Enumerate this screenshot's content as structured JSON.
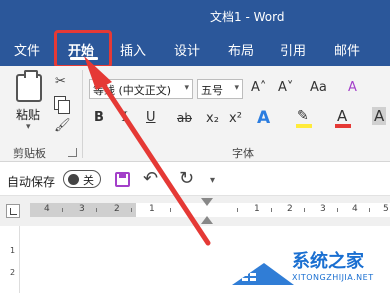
{
  "app": {
    "window_title": "文档1 - Word"
  },
  "tabs": [
    {
      "label": "文件"
    },
    {
      "label": "开始",
      "active": true
    },
    {
      "label": "插入"
    },
    {
      "label": "设计"
    },
    {
      "label": "布局"
    },
    {
      "label": "引用"
    },
    {
      "label": "邮件"
    }
  ],
  "ribbon": {
    "clipboard": {
      "paste_label": "粘贴",
      "group_label": "剪贴板"
    },
    "font": {
      "font_name": "等线 (中文正文)",
      "font_size": "五号",
      "grow_label": "A˄",
      "shrink_label": "A˅",
      "change_case_label": "Aa",
      "clear_format_label": "A",
      "bold": "B",
      "italic": "I",
      "underline": "U",
      "strike": "ab",
      "subscript": "x₂",
      "superscript": "x²",
      "text_effect": "A",
      "highlight": "✎",
      "font_color": "A",
      "shading": "A",
      "group_label": "字体"
    }
  },
  "quick_access": {
    "autosave_label": "自动保存",
    "autosave_state": "关"
  },
  "ruler": {
    "left_numbers": [
      "4",
      "3",
      "2",
      "1"
    ],
    "right_numbers": [
      "1",
      "2",
      "3",
      "4",
      "5"
    ]
  },
  "vertical_ruler": [
    "1",
    "2"
  ],
  "watermark": {
    "title": "系统之家",
    "subtitle": "XITONGZHIJIA.NET"
  },
  "colors": {
    "title_bar": "#2b579a",
    "highlight_box": "#e53935",
    "highlight_swatch": "#ffeb3b",
    "font_color_swatch": "#e53935",
    "watermark": "#1a6fd1"
  }
}
